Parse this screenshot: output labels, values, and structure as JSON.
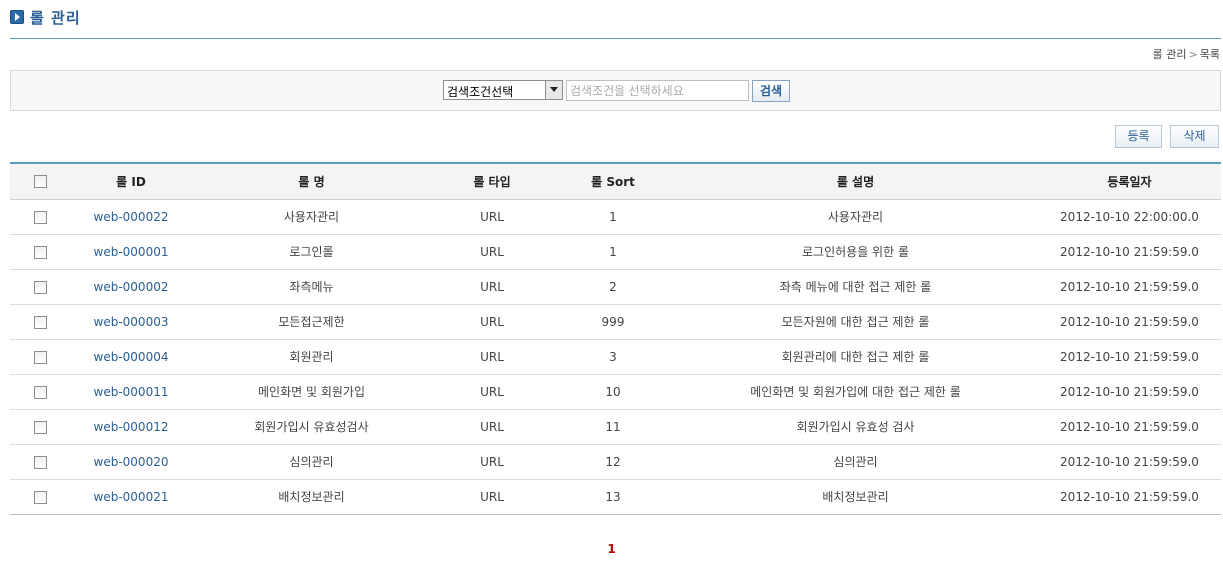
{
  "page": {
    "title": "롤 관리"
  },
  "breadcrumb": {
    "current_section": "롤 관리",
    "separator": ">",
    "current_page": "목록"
  },
  "search": {
    "condition_selected": "검색조건선택",
    "keyword_placeholder": "검색조건을 선택하세요",
    "button_label": "검색"
  },
  "actions": {
    "register_label": "등록",
    "delete_label": "삭제"
  },
  "table": {
    "headers": {
      "role_id": "롤 ID",
      "role_name": "롤 명",
      "role_type": "롤 타입",
      "role_sort": "롤 Sort",
      "role_desc": "롤 설명",
      "reg_date": "등록일자"
    },
    "rows": [
      {
        "id": "web-000022",
        "name": "사용자관리",
        "type": "URL",
        "sort": "1",
        "desc": "사용자관리",
        "date": "2012-10-10 22:00:00.0"
      },
      {
        "id": "web-000001",
        "name": "로그인롤",
        "type": "URL",
        "sort": "1",
        "desc": "로그인허용을 위한 롤",
        "date": "2012-10-10 21:59:59.0"
      },
      {
        "id": "web-000002",
        "name": "좌측메뉴",
        "type": "URL",
        "sort": "2",
        "desc": "좌측 메뉴에 대한 접근 제한 롤",
        "date": "2012-10-10 21:59:59.0"
      },
      {
        "id": "web-000003",
        "name": "모든접근제한",
        "type": "URL",
        "sort": "999",
        "desc": "모든자원에 대한 접근 제한 롤",
        "date": "2012-10-10 21:59:59.0"
      },
      {
        "id": "web-000004",
        "name": "회원관리",
        "type": "URL",
        "sort": "3",
        "desc": "회원관리에 대한 접근 제한 롤",
        "date": "2012-10-10 21:59:59.0"
      },
      {
        "id": "web-000011",
        "name": "메인화면 및 회원가입",
        "type": "URL",
        "sort": "10",
        "desc": "메인화면 및 회원가입에 대한 접근 제한 롤",
        "date": "2012-10-10 21:59:59.0"
      },
      {
        "id": "web-000012",
        "name": "회원가입시 유효성검사",
        "type": "URL",
        "sort": "11",
        "desc": "회원가입시 유효성 검사",
        "date": "2012-10-10 21:59:59.0"
      },
      {
        "id": "web-000020",
        "name": "심의관리",
        "type": "URL",
        "sort": "12",
        "desc": "심의관리",
        "date": "2012-10-10 21:59:59.0"
      },
      {
        "id": "web-000021",
        "name": "배치정보관리",
        "type": "URL",
        "sort": "13",
        "desc": "배치정보관리",
        "date": "2012-10-10 21:59:59.0"
      }
    ]
  },
  "pagination": {
    "current": "1"
  },
  "colors": {
    "accent": "#2b5f96",
    "rule": "#5a9bc4",
    "pager_active": "#c00000"
  }
}
